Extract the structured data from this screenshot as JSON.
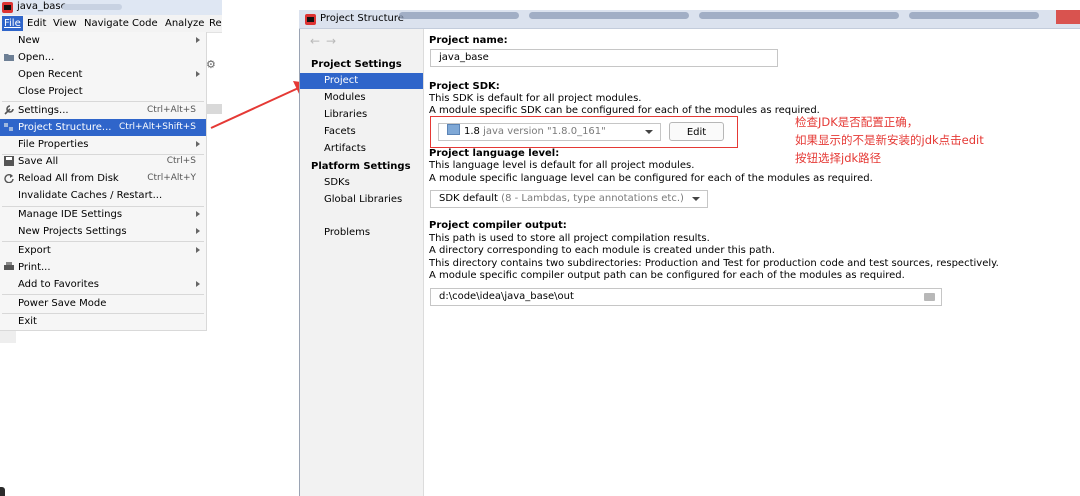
{
  "ide": {
    "window_title": "java_base",
    "menubar": [
      "File",
      "Edit",
      "View",
      "Navigate",
      "Code",
      "Analyze",
      "Re"
    ],
    "file_menu": [
      {
        "label": "New",
        "shortcut": "",
        "submenu": true
      },
      {
        "label": "Open...",
        "shortcut": "",
        "submenu": false
      },
      {
        "label": "Open Recent",
        "shortcut": "",
        "submenu": true
      },
      {
        "label": "Close Project",
        "shortcut": "",
        "submenu": false
      },
      {
        "label": "Settings...",
        "shortcut": "Ctrl+Alt+S",
        "submenu": false
      },
      {
        "label": "Project Structure...",
        "shortcut": "Ctrl+Alt+Shift+S",
        "submenu": false
      },
      {
        "label": "File Properties",
        "shortcut": "",
        "submenu": true
      },
      {
        "label": "Save All",
        "shortcut": "Ctrl+S",
        "submenu": false
      },
      {
        "label": "Reload All from Disk",
        "shortcut": "Ctrl+Alt+Y",
        "submenu": false
      },
      {
        "label": "Invalidate Caches / Restart...",
        "shortcut": "",
        "submenu": false
      },
      {
        "label": "Manage IDE Settings",
        "shortcut": "",
        "submenu": true
      },
      {
        "label": "New Projects Settings",
        "shortcut": "",
        "submenu": true
      },
      {
        "label": "Export",
        "shortcut": "",
        "submenu": true
      },
      {
        "label": "Print...",
        "shortcut": "",
        "submenu": false
      },
      {
        "label": "Add to Favorites",
        "shortcut": "",
        "submenu": true
      },
      {
        "label": "Power Save Mode",
        "shortcut": "",
        "submenu": false
      },
      {
        "label": "Exit",
        "shortcut": "",
        "submenu": false
      }
    ]
  },
  "dialog": {
    "title": "Project Structure",
    "nav": {
      "project_settings_header": "Project Settings",
      "project_settings_items": [
        "Project",
        "Modules",
        "Libraries",
        "Facets",
        "Artifacts"
      ],
      "platform_settings_header": "Platform Settings",
      "platform_settings_items": [
        "SDKs",
        "Global Libraries"
      ],
      "problems": "Problems"
    },
    "project_name": {
      "label": "Project name:",
      "value": "java_base"
    },
    "project_sdk": {
      "label": "Project SDK:",
      "desc1": "This SDK is default for all project modules.",
      "desc2": "A module specific SDK can be configured for each of the modules as required.",
      "selected_version": "1.8",
      "selected_detail": "java version \"1.8.0_161\"",
      "edit_label": "Edit"
    },
    "language_level": {
      "label": "Project language level:",
      "desc1": "This language level is default for all project modules.",
      "desc2": "A module specific language level can be configured for each of the modules as required.",
      "selected": "SDK default",
      "selected_detail": "(8 - Lambdas, type annotations etc.)"
    },
    "compiler_output": {
      "label": "Project compiler output:",
      "desc1": "This path is used to store all project compilation results.",
      "desc2": "A directory corresponding to each module is created under this path.",
      "desc3": "This directory contains two subdirectories: Production and Test for production code and test sources, respectively.",
      "desc4": "A module specific compiler output path can be configured for each of the modules as required.",
      "path": "d:\\code\\idea\\java_base\\out"
    }
  },
  "annotation": {
    "line1": "检查JDK是否配置正确，",
    "line2": "如果显示的不是新安装的jdk点击edit",
    "line3": "按钮选择jdk路径"
  },
  "colors": {
    "selection": "#2f65ca",
    "annotation_red": "#e53935"
  }
}
